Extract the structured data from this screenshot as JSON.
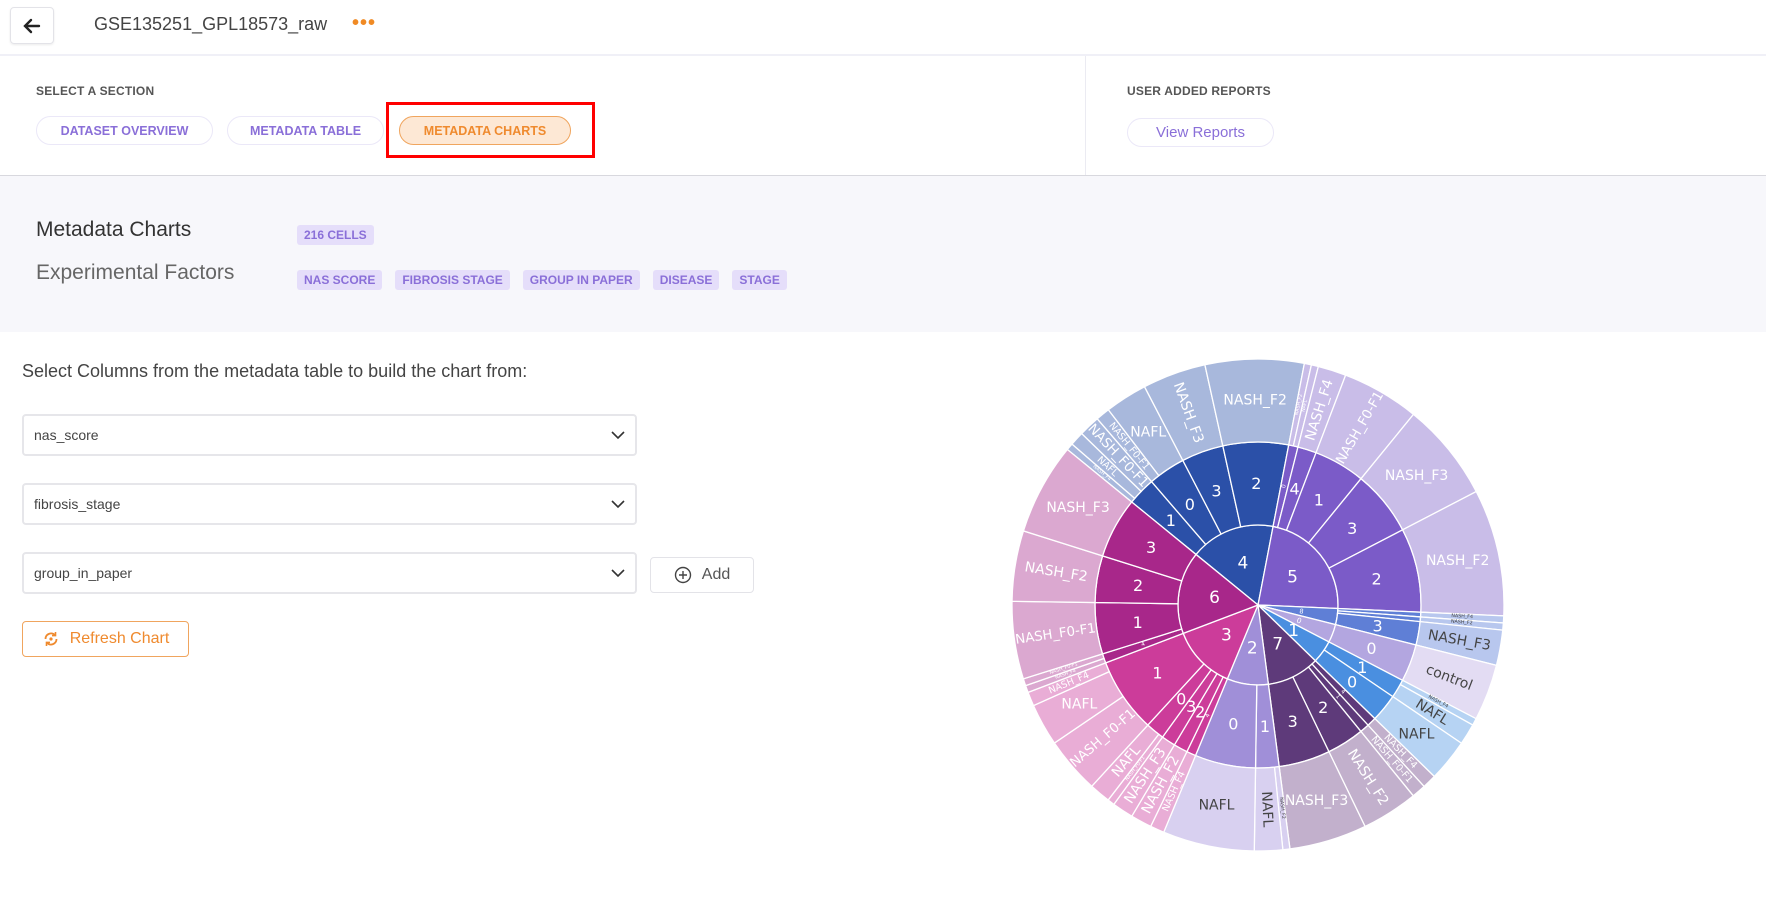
{
  "header": {
    "title": "GSE135251_GPL18573_raw",
    "more_icon": "ellipsis-icon",
    "back_icon": "arrow-left-icon"
  },
  "sections": {
    "label": "SELECT A SECTION",
    "tabs": [
      {
        "label": "DATASET OVERVIEW",
        "active": false
      },
      {
        "label": "METADATA TABLE",
        "active": false
      },
      {
        "label": "METADATA CHARTS",
        "active": true
      }
    ]
  },
  "reports": {
    "label": "USER ADDED REPORTS",
    "button": "View Reports"
  },
  "summary": {
    "title": "Metadata Charts",
    "cells_badge": "216 CELLS",
    "factors_title": "Experimental Factors",
    "factors": [
      "NAS SCORE",
      "FIBROSIS STAGE",
      "GROUP IN PAPER",
      "DISEASE",
      "STAGE"
    ]
  },
  "builder": {
    "prompt": "Select Columns from the metadata table to build the chart from:",
    "columns": [
      "nas_score",
      "fibrosis_stage",
      "group_in_paper"
    ],
    "add_label": "Add",
    "refresh_label": "Refresh Chart"
  },
  "colors": {
    "accent": "#ef8a2e",
    "primary": "#8a6fd8",
    "highlight_box": "#ff0000"
  },
  "chart_data": {
    "type": "sunburst",
    "levels": [
      "nas_score",
      "fibrosis_stage",
      "group_in_paper"
    ],
    "total": 216,
    "nodes": [
      {
        "label": "4",
        "value": 37,
        "color": "#2b50a8",
        "outer_color": "#a8b8dc",
        "outer_text": "#ffffff",
        "children": [
          {
            "label": "1",
            "children": [
              {
                "label": "NASH_F4",
                "value": 1
              },
              {
                "label": "NAFL",
                "value": 2
              },
              {
                "label": "NASH_F0-F1",
                "value": 3
              }
            ]
          },
          {
            "label": "0",
            "children": [
              {
                "label": "NASH_F0-F1",
                "value": 2
              },
              {
                "label": "NAFL",
                "value": 6
              }
            ]
          },
          {
            "label": "3",
            "children": [
              {
                "label": "NASH_F3",
                "value": 9
              }
            ]
          },
          {
            "label": "2",
            "children": [
              {
                "label": "NASH_F2",
                "value": 14
              }
            ]
          }
        ]
      },
      {
        "label": "5",
        "value": 49,
        "color": "#7b5bc8",
        "outer_color": "#c9bde8",
        "outer_text": "#ffffff",
        "children": [
          {
            "label": "0",
            "children": [
              {
                "label": "NASH_F2",
                "value": 1
              },
              {
                "label": "NAFL",
                "value": 1
              }
            ]
          },
          {
            "label": "4",
            "children": [
              {
                "label": "NASH_F4",
                "value": 4
              }
            ]
          },
          {
            "label": "1",
            "children": [
              {
                "label": "NASH_F0-F1",
                "value": 11
              }
            ]
          },
          {
            "label": "3",
            "children": [
              {
                "label": "NASH_F3",
                "value": 14
              }
            ]
          },
          {
            "label": "2",
            "children": [
              {
                "label": "NASH_F2",
                "value": 18
              }
            ]
          }
        ]
      },
      {
        "label": "8",
        "value": 7,
        "color": "#5f7fd6",
        "outer_color": "#b8c7ee",
        "outer_text": "#444444",
        "children": [
          {
            "label": "4",
            "children": [
              {
                "label": "NASH_F4",
                "value": 1
              }
            ]
          },
          {
            "label": "2",
            "children": [
              {
                "label": "NASH_F2",
                "value": 1
              }
            ]
          },
          {
            "label": "3",
            "children": [
              {
                "label": "NASH_F3",
                "value": 5
              }
            ]
          }
        ]
      },
      {
        "label": "0",
        "value": 8,
        "color": "#b3a6e0",
        "outer_color": "#e3dcf3",
        "outer_text": "#444444",
        "children": [
          {
            "label": "0",
            "children": [
              {
                "label": "control",
                "value": 8
              }
            ]
          }
        ]
      },
      {
        "label": "1",
        "value": 10,
        "color": "#4a8fe0",
        "outer_color": "#b6d3f3",
        "outer_text": "#444444",
        "children": [
          {
            "label": "1",
            "children": [
              {
                "label": "NASH_F4",
                "value": 1
              },
              {
                "label": "NAFL",
                "value": 3
              }
            ]
          },
          {
            "label": "0",
            "children": [
              {
                "label": "NAFL",
                "value": 6
              }
            ]
          }
        ]
      },
      {
        "label": "7",
        "value": 23,
        "color": "#5e3a7a",
        "outer_color": "#c2b0cc",
        "outer_text": "#ffffff",
        "children": [
          {
            "label": "4",
            "children": [
              {
                "label": "NASH_F4",
                "value": 2
              }
            ]
          },
          {
            "label": "1",
            "children": [
              {
                "label": "NASH_F0-F1",
                "value": 2
              }
            ]
          },
          {
            "label": "2",
            "children": [
              {
                "label": "NASH_F2",
                "value": 8
              }
            ]
          },
          {
            "label": "3",
            "children": [
              {
                "label": "NASH_F3",
                "value": 11
              }
            ]
          }
        ]
      },
      {
        "label": "2",
        "value": 18,
        "color": "#a08fd8",
        "outer_color": "#d8d0f0",
        "outer_text": "#444444",
        "children": [
          {
            "label": "1",
            "children": [
              {
                "label": "NASH_F2",
                "value": 1
              },
              {
                "label": "NAFL",
                "value": 4
              }
            ]
          },
          {
            "label": "0",
            "children": [
              {
                "label": "NAFL",
                "value": 13
              }
            ]
          }
        ]
      },
      {
        "label": "3",
        "value": 28,
        "color": "#cc3c9a",
        "outer_color": "#e9add6",
        "outer_text": "#ffffff",
        "children": [
          {
            "label": "4",
            "children": [
              {
                "label": "NASH_F4",
                "value": 2
              }
            ]
          },
          {
            "label": "2",
            "children": [
              {
                "label": "NASH_F2",
                "value": 3
              }
            ]
          },
          {
            "label": "3",
            "children": [
              {
                "label": "NASH_F3",
                "value": 3
              }
            ]
          },
          {
            "label": "0",
            "children": [
              {
                "label": "NASH_F0-F1",
                "value": 1
              },
              {
                "label": "NAFL",
                "value": 3
              }
            ]
          },
          {
            "label": "1",
            "children": [
              {
                "label": "NASH_F0-F1",
                "value": 8
              },
              {
                "label": "NAFL",
                "value": 6
              },
              {
                "label": "NASH_F4",
                "value": 2
              }
            ]
          }
        ]
      },
      {
        "label": "6",
        "value": 36,
        "color": "#a8278a",
        "outer_color": "#dba8d0",
        "outer_text": "#ffffff",
        "children": [
          {
            "label": "4",
            "children": [
              {
                "label": "NASH_F4",
                "value": 1
              },
              {
                "label": "NASH_F0-F1",
                "value": 1
              }
            ]
          },
          {
            "label": "1",
            "children": [
              {
                "label": "NASH_F0-F1",
                "value": 11
              }
            ]
          },
          {
            "label": "2",
            "children": [
              {
                "label": "NASH_F2",
                "value": 10
              }
            ]
          },
          {
            "label": "3",
            "children": [
              {
                "label": "NASH_F3",
                "value": 13
              }
            ]
          }
        ]
      }
    ]
  }
}
